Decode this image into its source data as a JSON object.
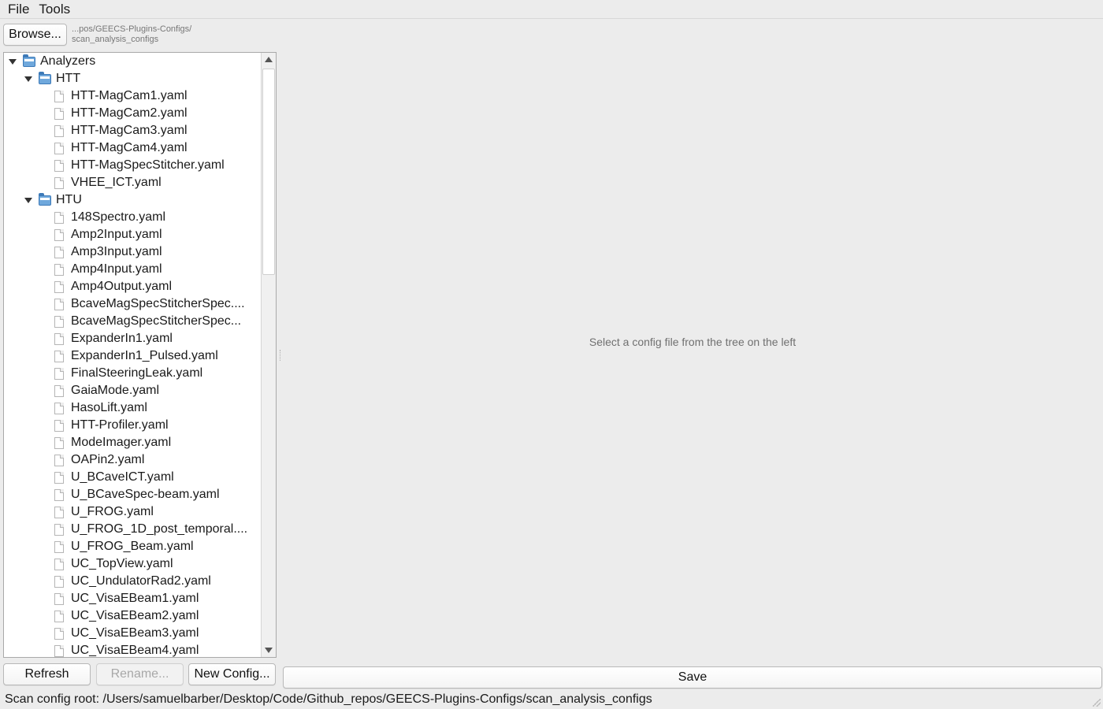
{
  "menubar": {
    "file": "File",
    "tools": "Tools"
  },
  "toolbar": {
    "browse_label": "Browse...",
    "path_line1": "...pos/GEECS-Plugins-Configs/",
    "path_line2": "scan_analysis_configs"
  },
  "tree": {
    "root": "Analyzers",
    "groups": [
      {
        "name": "HTT",
        "files": [
          "HTT-MagCam1.yaml",
          "HTT-MagCam2.yaml",
          "HTT-MagCam3.yaml",
          "HTT-MagCam4.yaml",
          "HTT-MagSpecStitcher.yaml",
          "VHEE_ICT.yaml"
        ]
      },
      {
        "name": "HTU",
        "files": [
          "148Spectro.yaml",
          "Amp2Input.yaml",
          "Amp3Input.yaml",
          "Amp4Input.yaml",
          "Amp4Output.yaml",
          "BcaveMagSpecStitcherSpec....",
          "BcaveMagSpecStitcherSpec...",
          "ExpanderIn1.yaml",
          "ExpanderIn1_Pulsed.yaml",
          "FinalSteeringLeak.yaml",
          "GaiaMode.yaml",
          "HasoLift.yaml",
          "HTT-Profiler.yaml",
          "ModeImager.yaml",
          "OAPin2.yaml",
          "U_BCaveICT.yaml",
          "U_BCaveSpec-beam.yaml",
          "U_FROG.yaml",
          "U_FROG_1D_post_temporal....",
          "U_FROG_Beam.yaml",
          "UC_TopView.yaml",
          "UC_UndulatorRad2.yaml",
          "UC_VisaEBeam1.yaml",
          "UC_VisaEBeam2.yaml",
          "UC_VisaEBeam3.yaml",
          "UC_VisaEBeam4.yaml"
        ]
      }
    ]
  },
  "content": {
    "placeholder": "Select a config file from the tree on the left"
  },
  "buttons": {
    "refresh": "Refresh",
    "rename": "Rename...",
    "new_config": "New Config...",
    "save": "Save"
  },
  "status": {
    "text": "Scan config root: /Users/samuelbarber/Desktop/Code/Github_repos/GEECS-Plugins-Configs/scan_analysis_configs"
  },
  "icons": {
    "folder": "folder-icon",
    "file": "file-icon",
    "expand": "chevron-down-icon"
  },
  "colors": {
    "folder_blue": "#6fa8dc",
    "background": "#ececec"
  }
}
